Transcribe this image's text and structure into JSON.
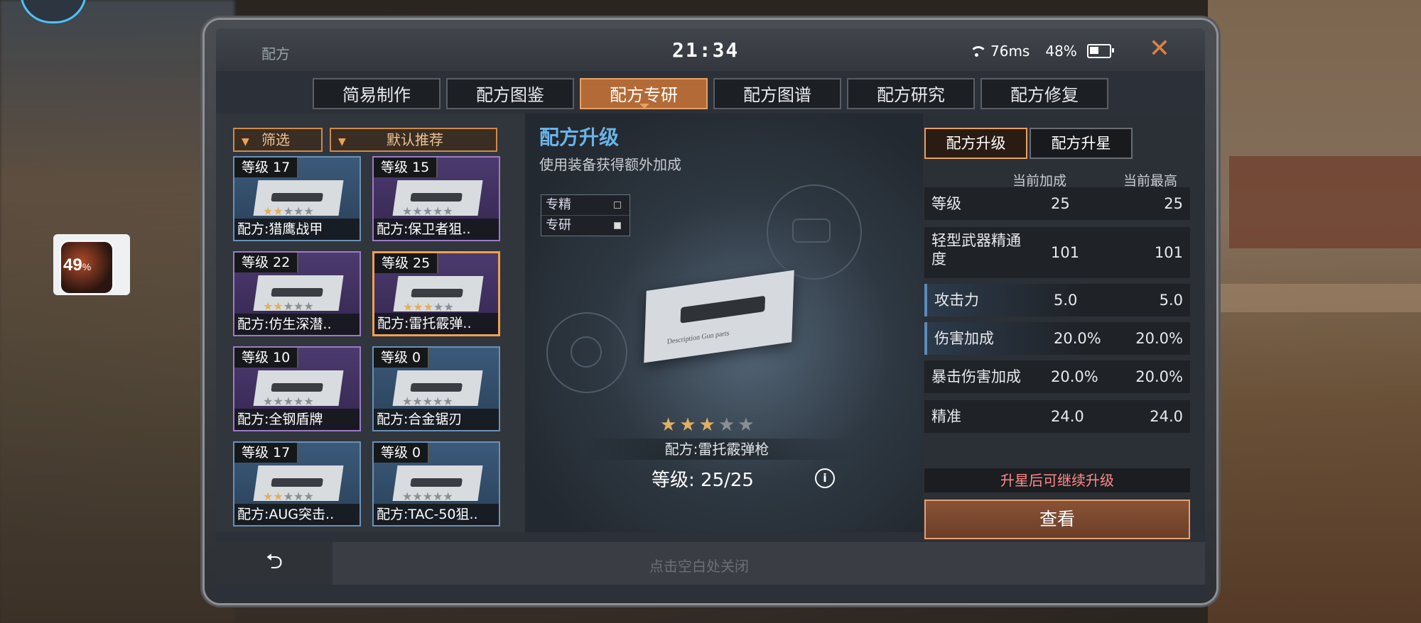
{
  "overlay": {
    "percent": "49",
    "percent_unit": "%"
  },
  "status_bar": {
    "app_title": "配方",
    "clock": "21:34",
    "ping": "76ms",
    "battery": "48%",
    "battery_level": 0.48
  },
  "tabs": [
    "简易制作",
    "配方图鉴",
    "配方专研",
    "配方图谱",
    "配方研究",
    "配方修复"
  ],
  "active_tab": 2,
  "filters": {
    "filter_label": "筛选",
    "sort_label": "默认推荐"
  },
  "cards": [
    {
      "level": "等级 17",
      "name": "配方:猎鹰战甲",
      "rarity": "blue",
      "stars_on": 2,
      "stars_total": 5
    },
    {
      "level": "等级 15",
      "name": "配方:保卫者狙..",
      "rarity": "purple",
      "stars_on": 0,
      "stars_total": 5
    },
    {
      "level": "等级 22",
      "name": "配方:仿生深潜..",
      "rarity": "purple",
      "stars_on": 2,
      "stars_total": 5
    },
    {
      "level": "等级 25",
      "name": "配方:雷托霰弹..",
      "rarity": "purple",
      "stars_on": 3,
      "stars_total": 5,
      "selected": true
    },
    {
      "level": "等级 10",
      "name": "配方:全钢盾牌",
      "rarity": "purple",
      "stars_on": 0,
      "stars_total": 5
    },
    {
      "level": "等级 0",
      "name": "配方:合金锯刃",
      "rarity": "blue",
      "stars_on": 0,
      "stars_total": 5
    },
    {
      "level": "等级 17",
      "name": "配方:AUG突击..",
      "rarity": "blue",
      "stars_on": 2,
      "stars_total": 5
    },
    {
      "level": "等级 0",
      "name": "配方:TAC-50狙..",
      "rarity": "blue",
      "stars_on": 0,
      "stars_total": 5
    }
  ],
  "center": {
    "title": "配方升级",
    "subtitle": "使用装备获得额外加成",
    "legend": [
      {
        "label": "专精",
        "checked": false
      },
      {
        "label": "专研",
        "checked": true
      }
    ],
    "blueprint_text": "Description   Gun parts",
    "stars_on": 3,
    "stars_total": 5,
    "recipe_name": "配方:雷托霰弹枪",
    "level_text": "等级: 25/25"
  },
  "right": {
    "tab_upgrade": "配方升级",
    "tab_star": "配方升星",
    "col_current": "当前加成",
    "col_max": "当前最高",
    "stats": [
      {
        "label": "等级",
        "current": "25",
        "max": "25",
        "accent": false
      },
      {
        "label": "轻型武器精通度",
        "current": "101",
        "max": "101",
        "accent": false
      },
      {
        "label": "攻击力",
        "current": "5.0",
        "max": "5.0",
        "accent": true
      },
      {
        "label": "伤害加成",
        "current": "20.0%",
        "max": "20.0%",
        "accent": true
      },
      {
        "label": "暴击伤害加成",
        "current": "20.0%",
        "max": "20.0%",
        "accent": false
      },
      {
        "label": "精准",
        "current": "24.0",
        "max": "24.0",
        "accent": false
      }
    ],
    "notice": "升星后可继续升级",
    "view_button": "查看"
  },
  "bottom": {
    "close_hint": "点击空白处关闭"
  }
}
